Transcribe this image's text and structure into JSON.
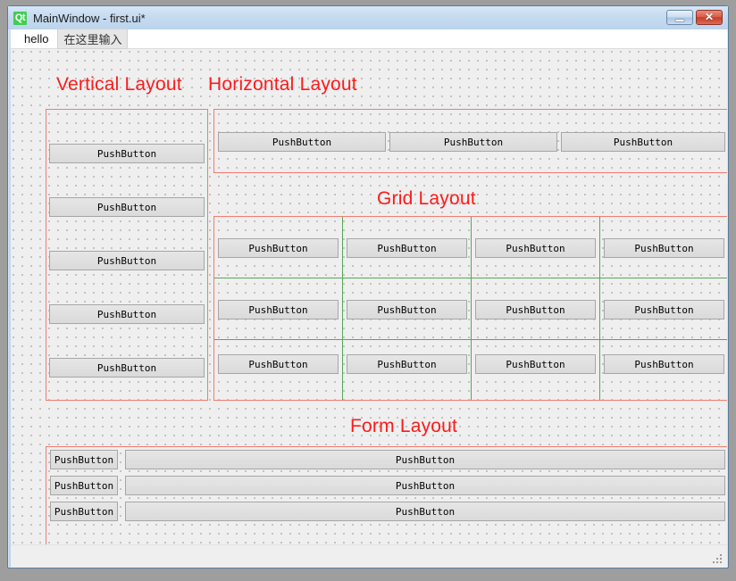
{
  "window": {
    "title": "MainWindow - first.ui*",
    "logo_text": "Qt",
    "minimize_label": "–",
    "close_label": "✕"
  },
  "menubar": {
    "items": [
      {
        "label": "hello",
        "placeholder": false
      },
      {
        "label": "在这里输入",
        "placeholder": true
      }
    ]
  },
  "colors": {
    "heading": "#fc1b1b",
    "layout_border": "#f47b6e",
    "grid_line": "#55aa55",
    "canvas": "#efefef",
    "button_face": "#e0e0e0",
    "button_border": "#a6a6a6",
    "titlebar": "#c5daef"
  },
  "sections": {
    "vertical": {
      "heading": "Vertical Layout",
      "buttons": [
        "PushButton",
        "PushButton",
        "PushButton",
        "PushButton",
        "PushButton"
      ]
    },
    "horizontal": {
      "heading": "Horizontal Layout",
      "buttons": [
        "PushButton",
        "PushButton",
        "PushButton"
      ]
    },
    "grid": {
      "heading": "Grid Layout",
      "rows": [
        [
          "PushButton",
          "PushButton",
          "PushButton",
          "PushButton"
        ],
        [
          "PushButton",
          "PushButton",
          "PushButton",
          "PushButton"
        ],
        [
          "PushButton",
          "PushButton",
          "PushButton",
          "PushButton"
        ]
      ]
    },
    "form": {
      "heading": "Form Layout",
      "rows": [
        {
          "label_button": "PushButton",
          "field_button": "PushButton"
        },
        {
          "label_button": "PushButton",
          "field_button": "PushButton"
        },
        {
          "label_button": "PushButton",
          "field_button": "PushButton"
        }
      ]
    }
  }
}
